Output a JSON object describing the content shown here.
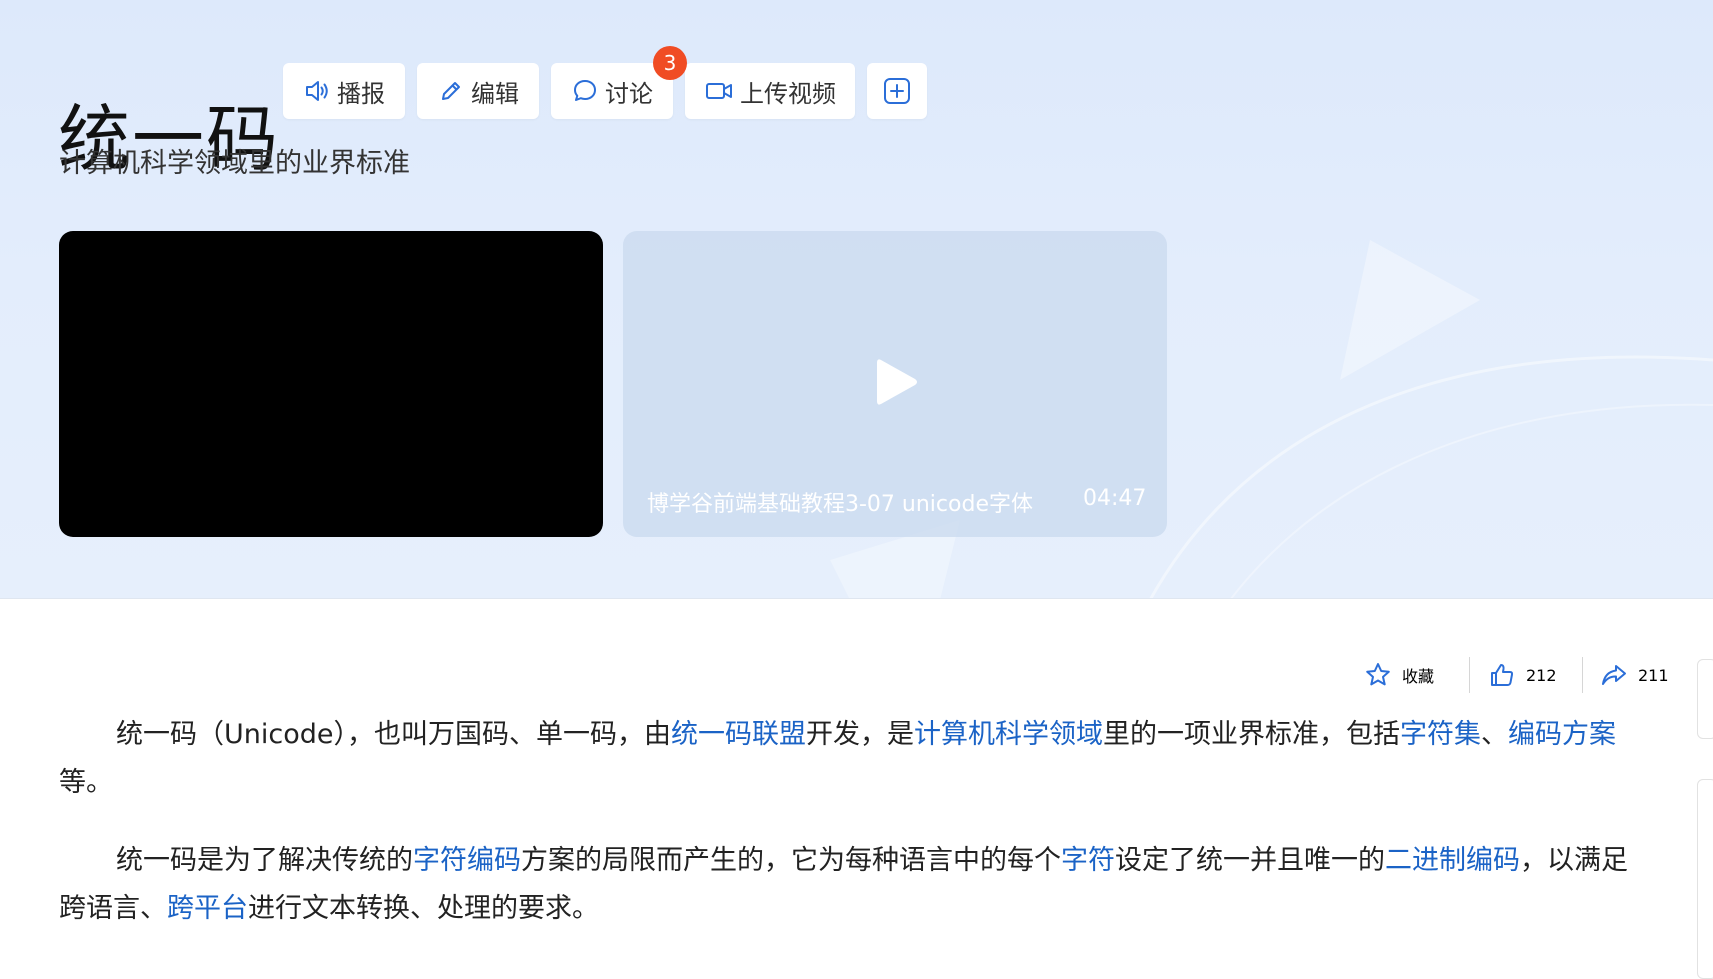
{
  "header": {
    "title": "统一码",
    "subtitle": "计算机科学领域里的业界标准"
  },
  "actions": {
    "broadcast": "播报",
    "edit": "编辑",
    "discuss": "讨论",
    "discuss_badge": "3",
    "upload_video": "上传视频"
  },
  "video": {
    "caption": "博学谷前端基础教程3-07 unicode字体",
    "duration": "04:47"
  },
  "stats": {
    "favorite_label": "收藏",
    "likes": "212",
    "shares": "211"
  },
  "paragraph1": {
    "t1": "统一码（Unicode），也叫万国码、单一码，由",
    "l1": "统一码联盟",
    "t2": "开发，是",
    "l2": "计算机科学领域",
    "t3": "里的一项业界标准，包括",
    "l3": "字符集",
    "t4": "、",
    "l4": "编码方案",
    "t5": "等。"
  },
  "paragraph2": {
    "t1": "统一码是为了解决传统的",
    "l1": "字符编码",
    "t2": "方案的局限而产生的，它为每种语言中的每个",
    "l2": "字符",
    "t3": "设定了统一并且唯一的",
    "l3": "二进制编码",
    "t4": "，以满足跨语言、",
    "l4": "跨平台",
    "t5": "进行文本转换、处理的要求。"
  },
  "colors": {
    "link": "#1b63c6",
    "badge": "#f04c24",
    "icon_blue": "#2b6ed8"
  },
  "icons": [
    "speaker-icon",
    "pencil-icon",
    "chat-bubble-icon",
    "video-camera-icon",
    "plus-square-icon",
    "play-icon",
    "star-icon",
    "thumbs-up-icon",
    "share-arrow-icon"
  ]
}
